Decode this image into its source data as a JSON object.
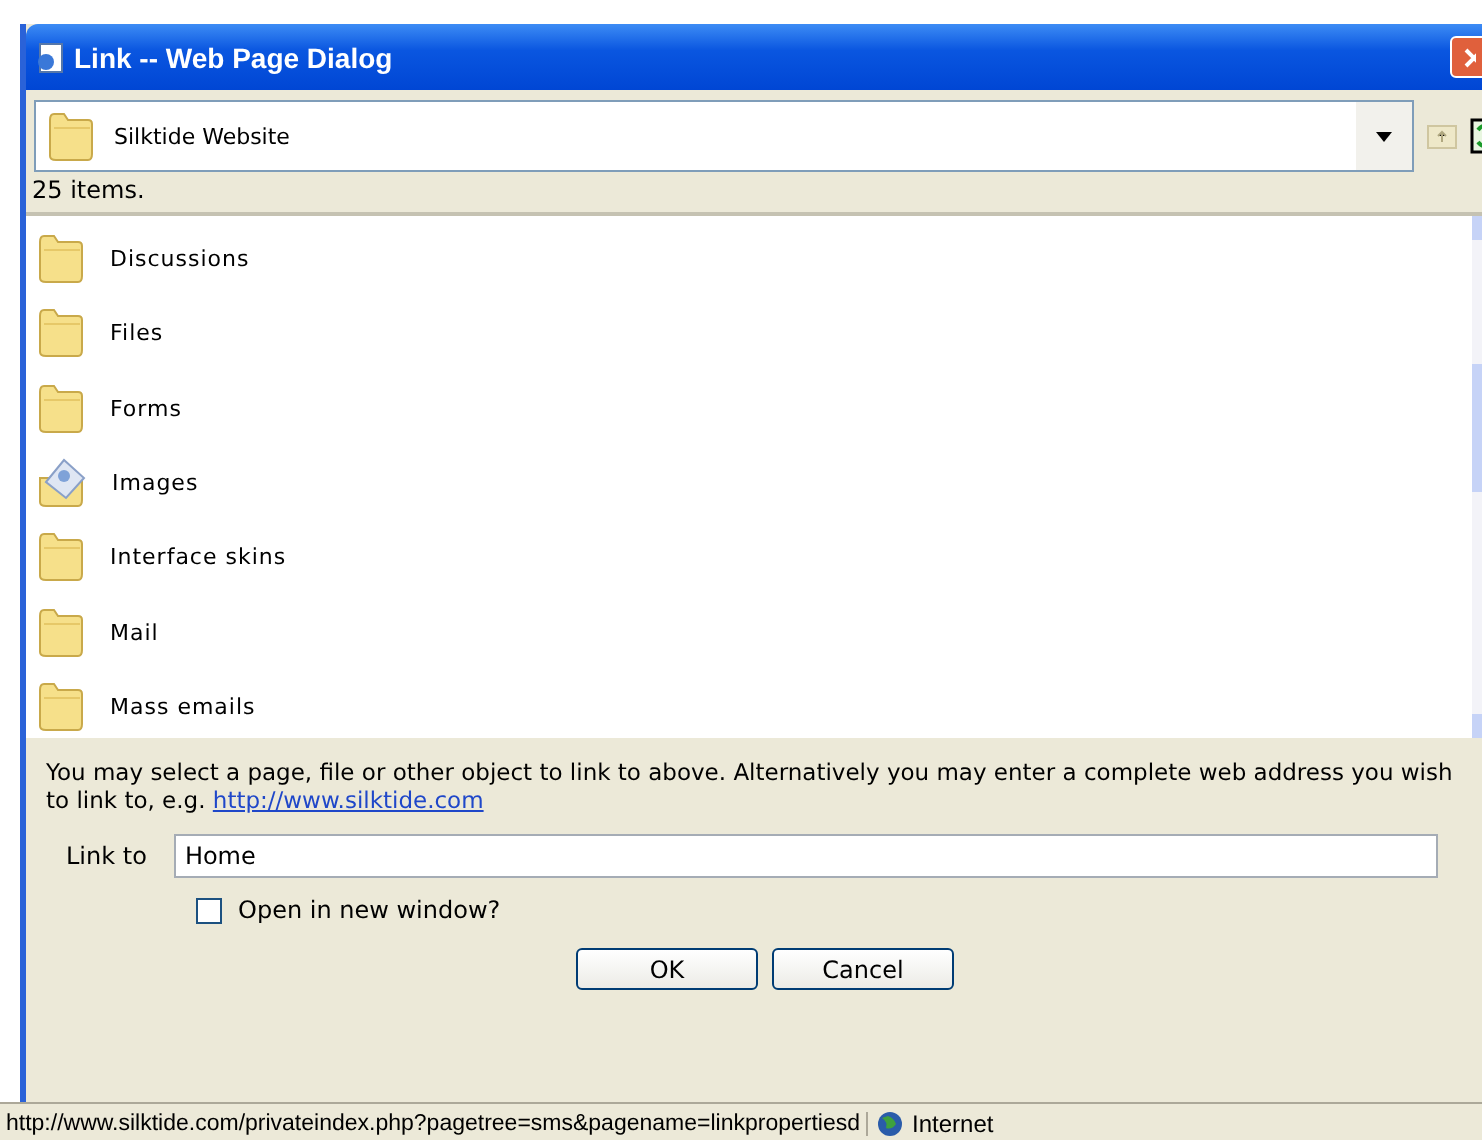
{
  "window": {
    "title": "Link -- Web Page Dialog"
  },
  "location": {
    "value": "Silktide Website"
  },
  "item_count": "25 items.",
  "items": [
    {
      "label": "Discussions",
      "kind": "folder"
    },
    {
      "label": "Files",
      "kind": "folder"
    },
    {
      "label": "Forms",
      "kind": "folder"
    },
    {
      "label": "Images",
      "kind": "images"
    },
    {
      "label": "Interface skins",
      "kind": "folder"
    },
    {
      "label": "Mail",
      "kind": "folder"
    },
    {
      "label": "Mass emails",
      "kind": "folder"
    }
  ],
  "instructions": {
    "text": "You may select a page, file or other object to link to above. Alternatively you may enter a complete web address you wish to link to, e.g.",
    "link": "http://www.silktide.com"
  },
  "link_to": {
    "label": "Link to",
    "value": "Home"
  },
  "new_window": {
    "label": "Open in new window?",
    "checked": false
  },
  "buttons": [
    "OK",
    "Cancel"
  ],
  "status_bar": {
    "url": "http://www.silktide.com/privateindex.php?pagetree=sms&pagename=linkpropertiesd",
    "zone": "Internet"
  }
}
